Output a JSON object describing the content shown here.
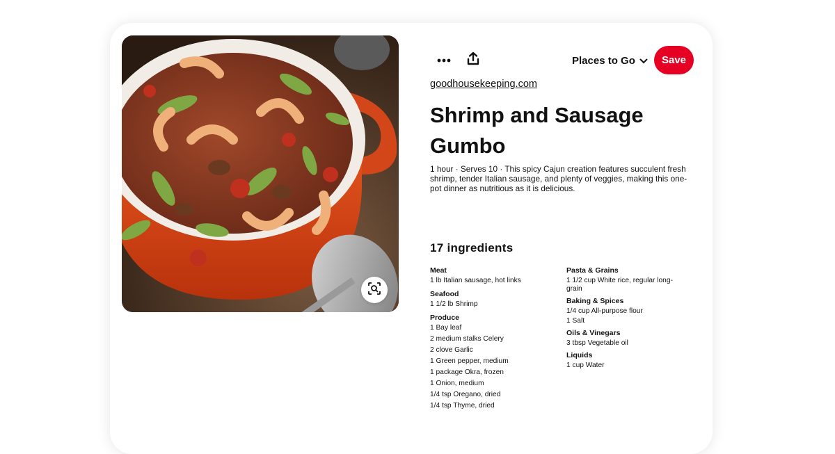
{
  "pin": {
    "source": "goodhousekeeping.com",
    "title": "Shrimp and Sausage Gumbo",
    "description": "1 hour · Serves 10 · This spicy Cajun creation features succulent fresh shrimp, tender Italian sausage, and plenty of veggies, making this one-pot dinner as nutritious as it is delicious.",
    "image_alt": "Shrimp and sausage gumbo in a red pot"
  },
  "toolbar": {
    "more_icon": "ellipsis-icon",
    "share_icon": "share-icon",
    "board_name": "Places to Go",
    "save_label": "Save",
    "save_color": "#e60023"
  },
  "ingredients": {
    "heading": "17 ingredients",
    "left_groups": [
      {
        "category": "Meat",
        "items": [
          "1 lb Italian sausage, hot links"
        ]
      },
      {
        "category": "Seafood",
        "items": [
          "1 1/2 lb Shrimp"
        ]
      },
      {
        "category": "Produce",
        "items": [
          "1 Bay leaf",
          "2 medium stalks Celery",
          "2 clove Garlic",
          "1 Green pepper, medium",
          "1 package Okra, frozen",
          "1 Onion, medium",
          "1/4 tsp Oregano, dried",
          "1/4 tsp Thyme, dried"
        ]
      }
    ],
    "right_groups": [
      {
        "category": "Pasta & Grains",
        "items": [
          "1 1/2 cup White rice, regular long-grain"
        ]
      },
      {
        "category": "Baking & Spices",
        "items": [
          "1/4 cup All-purpose flour",
          "1 Salt"
        ]
      },
      {
        "category": "Oils & Vinegars",
        "items": [
          "3 tbsp Vegetable oil"
        ]
      },
      {
        "category": "Liquids",
        "items": [
          "1 cup Water"
        ]
      }
    ]
  }
}
